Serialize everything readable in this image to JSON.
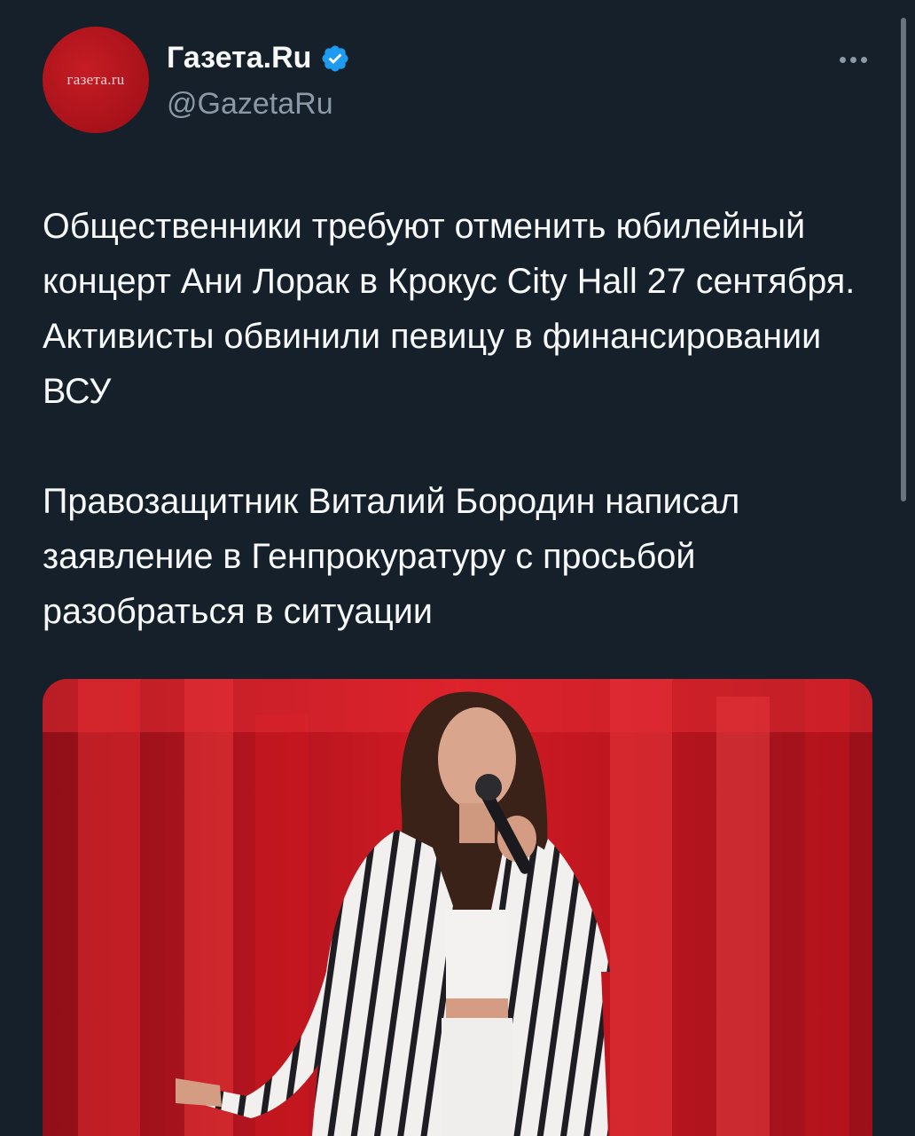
{
  "author": {
    "display_name": "Газета.Ru",
    "handle": "@GazetaRu",
    "avatar_text": "газета.ru",
    "avatar_color": "#b8141c",
    "verified": true,
    "verified_color": "#1d9bf0"
  },
  "tweet": {
    "paragraph_1": "Общественники требуют отменить юбилейный концерт Ани Лорак в Крокус City Hall 27 сентября. Активисты обвинили певицу в финансировании ВСУ",
    "paragraph_2": "Правозащитник Виталий Бородин написал заявление в Генпрокуратуру с просьбой разобраться в ситуации"
  },
  "icons": {
    "more": "more-horizontal-icon",
    "verified": "verified-badge-icon"
  },
  "theme": {
    "background": "#15202b",
    "text": "#f7f9f9",
    "secondary_text": "#8b98a5"
  }
}
